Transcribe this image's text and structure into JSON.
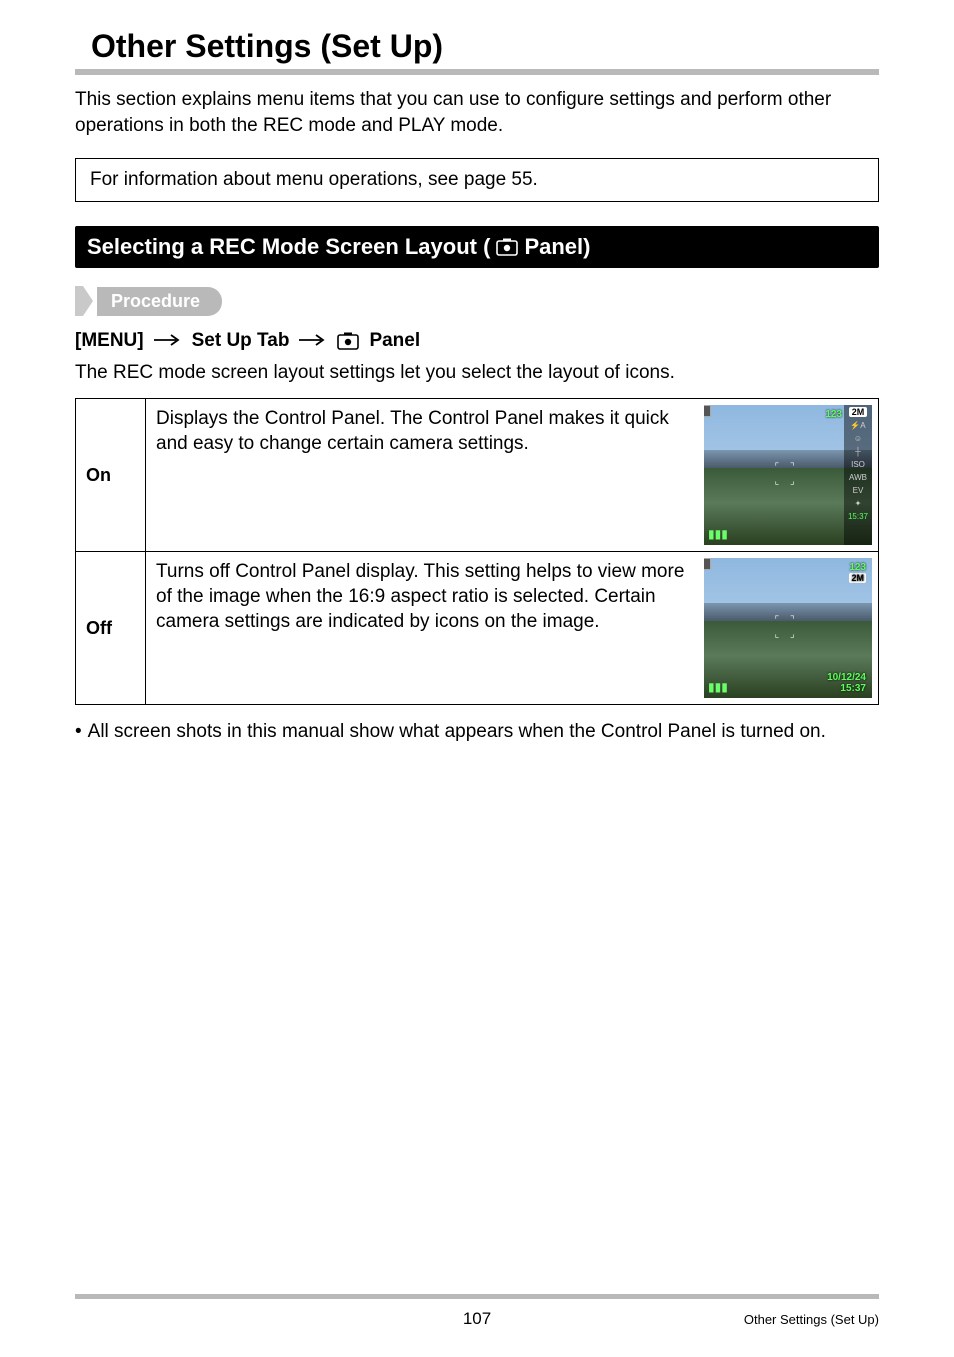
{
  "page": {
    "title": "Other Settings (Set Up)",
    "intro": "This section explains menu items that you can use to configure settings and perform other operations in both the REC mode and PLAY mode.",
    "info_box": "For information about menu operations, see page 55."
  },
  "section": {
    "heading_prefix": "Selecting a REC Mode Screen Layout (",
    "heading_suffix": " Panel)",
    "procedure_label": "Procedure",
    "path": {
      "p1": "[MENU]",
      "p2": "Set Up Tab",
      "p3": " Panel"
    },
    "description": "The REC mode screen layout settings let you select the layout of icons."
  },
  "options": [
    {
      "label": "On",
      "text": "Displays the Control Panel. The Control Panel makes it quick and easy to change certain camera settings.",
      "thumb": {
        "top_count": "123",
        "size_badge": "2M",
        "sidebar": [
          "⚡A",
          "☺",
          "┼",
          "ISO",
          "AWB",
          "EV",
          "✦",
          "15:37"
        ]
      }
    },
    {
      "label": "Off",
      "text": "Turns off Control Panel display. This setting helps to view more of the image when the 16:9 aspect ratio is selected. Certain camera settings are indicated by icons on the image.",
      "thumb": {
        "top_count": "123",
        "size_badge": "2M",
        "date": "10/12/24",
        "time": "15:37"
      }
    }
  ],
  "note": "All screen shots in this manual show what appears when the Control Panel is turned on.",
  "footer": {
    "page_number": "107",
    "label": "Other Settings (Set Up)"
  }
}
